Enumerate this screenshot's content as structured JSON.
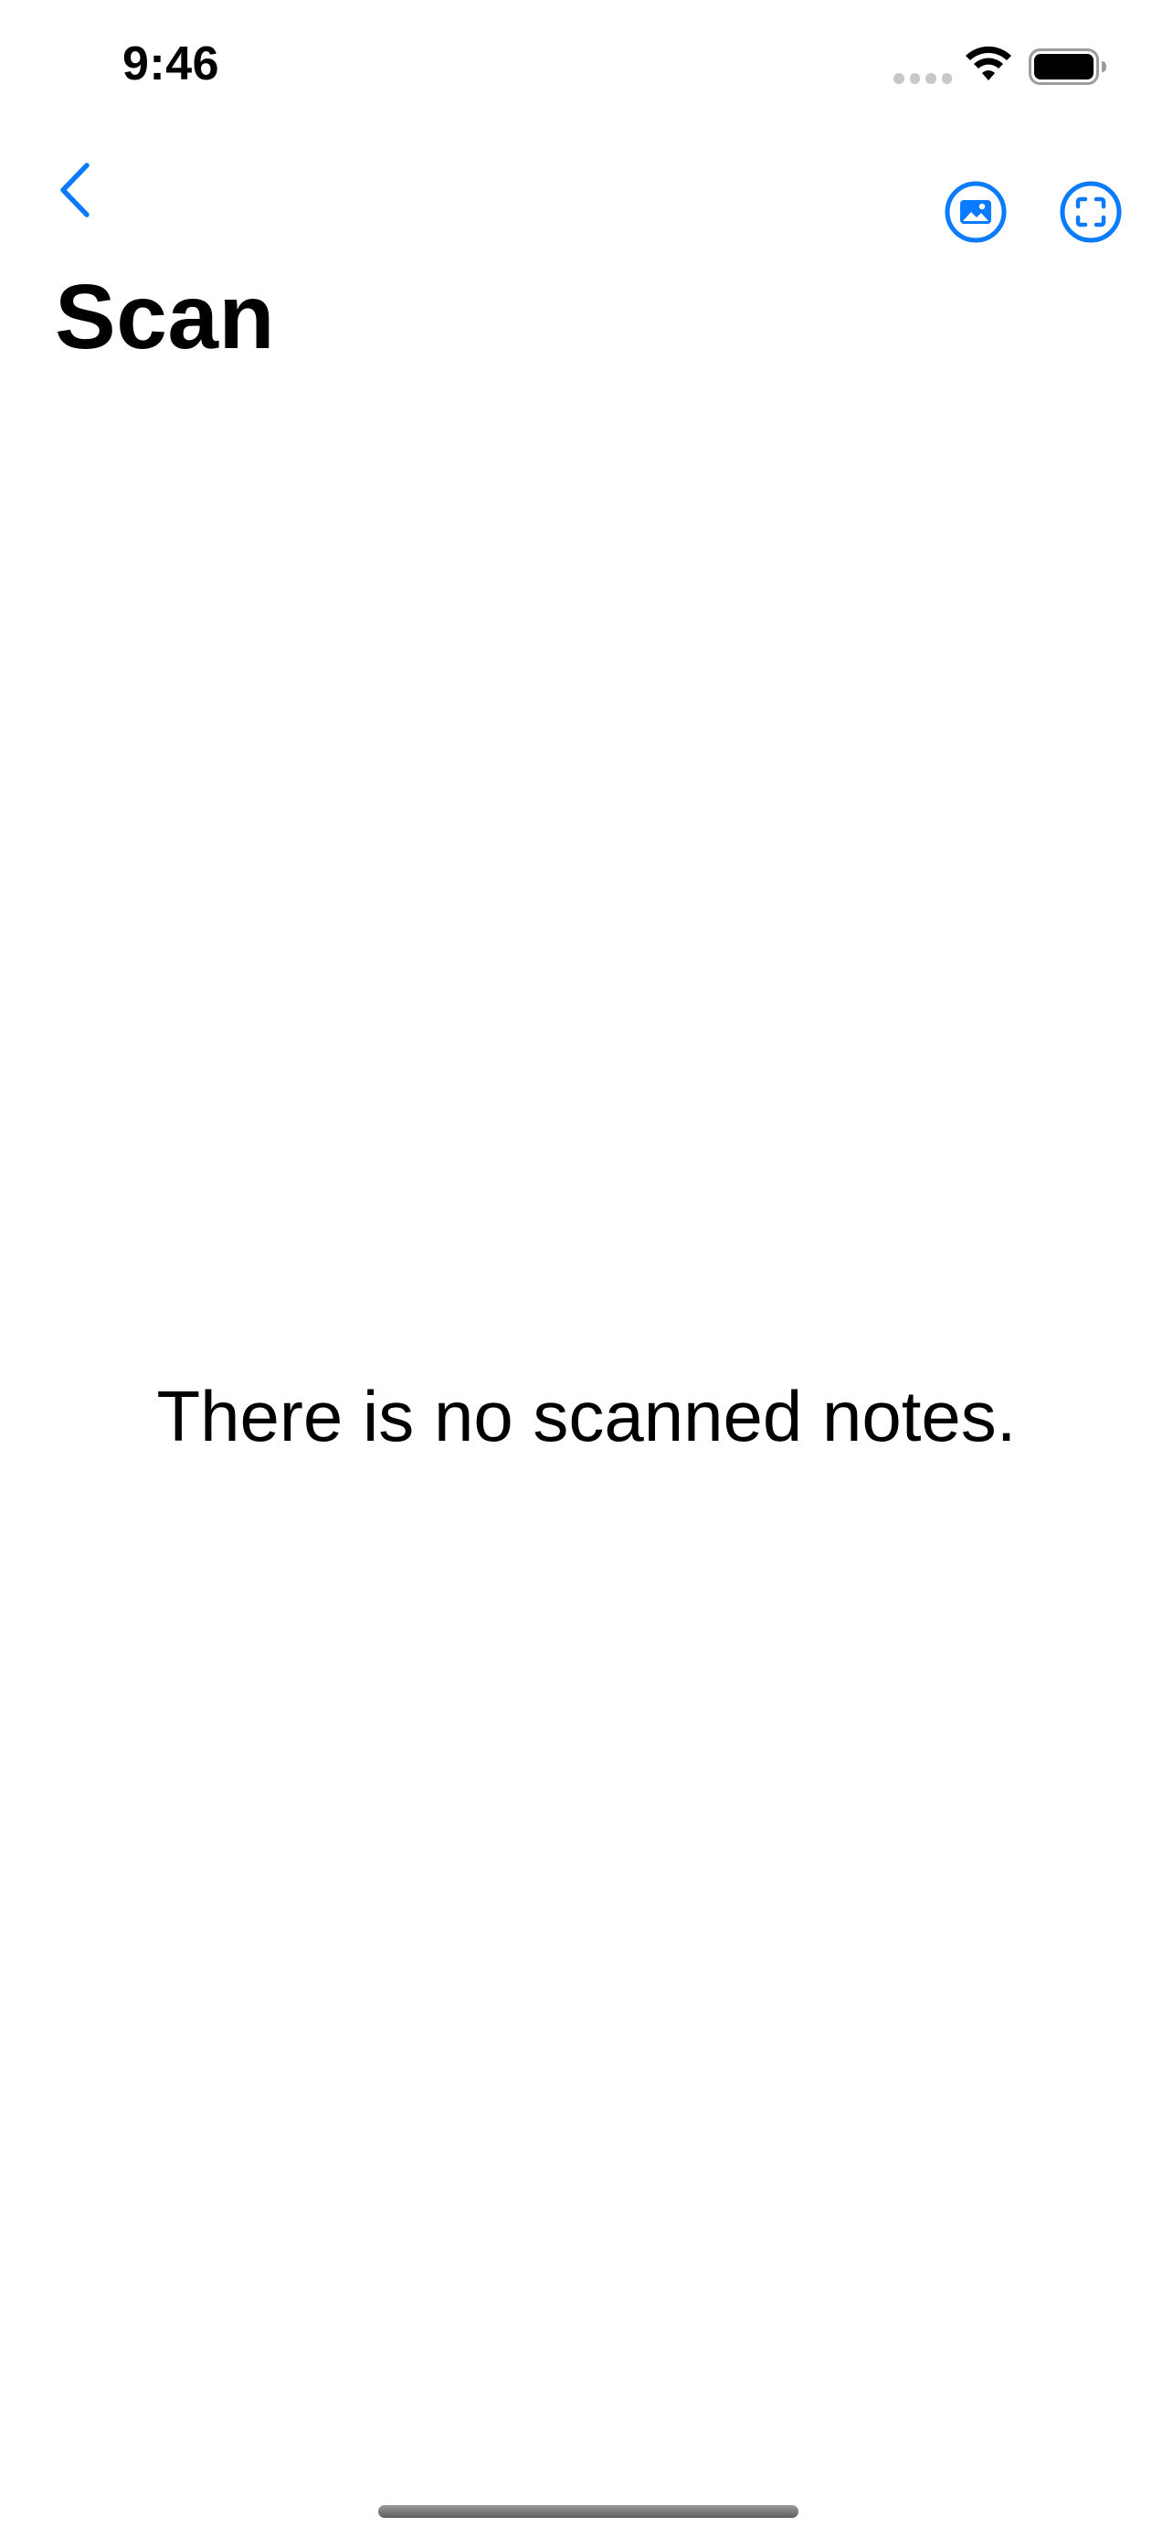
{
  "status_bar": {
    "time": "9:46"
  },
  "nav": {
    "title": "Scan",
    "back_icon": "chevron-left-icon",
    "actions": [
      {
        "icon": "photo-icon"
      },
      {
        "icon": "viewfinder-icon"
      }
    ]
  },
  "main": {
    "empty_message": "There is no scanned notes."
  },
  "colors": {
    "accent": "#0A7AFF",
    "text": "#000000",
    "background": "#FFFFFF"
  }
}
